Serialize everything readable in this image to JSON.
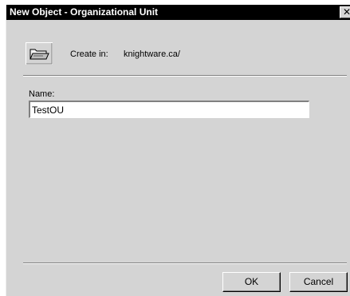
{
  "window": {
    "title": "New Object - Organizational Unit",
    "close_glyph": "✕"
  },
  "header": {
    "icon": "organizational-unit-folder-icon",
    "create_in_label": "Create in:",
    "create_in_value": "knightware.ca/"
  },
  "form": {
    "name_label": "Name:",
    "name_value": "TestOU"
  },
  "buttons": {
    "ok_label": "OK",
    "cancel_label": "Cancel"
  },
  "colors": {
    "titlebar": "#000000",
    "face": "#d4d4d4",
    "shadow": "#808080",
    "highlight": "#ffffff"
  }
}
